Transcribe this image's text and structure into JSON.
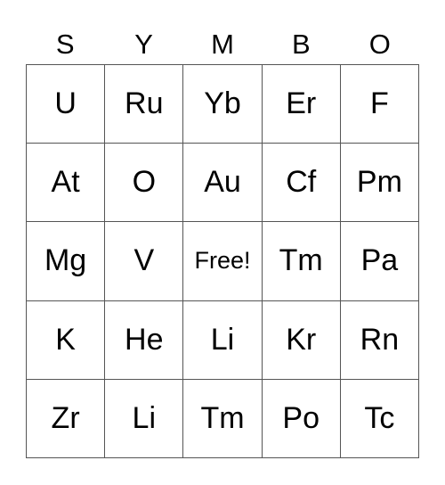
{
  "header": [
    "S",
    "Y",
    "M",
    "B",
    "O"
  ],
  "rows": [
    [
      "U",
      "Ru",
      "Yb",
      "Er",
      "F"
    ],
    [
      "At",
      "O",
      "Au",
      "Cf",
      "Pm"
    ],
    [
      "Mg",
      "V",
      "Free!",
      "Tm",
      "Pa"
    ],
    [
      "K",
      "He",
      "Li",
      "Kr",
      "Rn"
    ],
    [
      "Zr",
      "Li",
      "Tm",
      "Po",
      "Tc"
    ]
  ]
}
